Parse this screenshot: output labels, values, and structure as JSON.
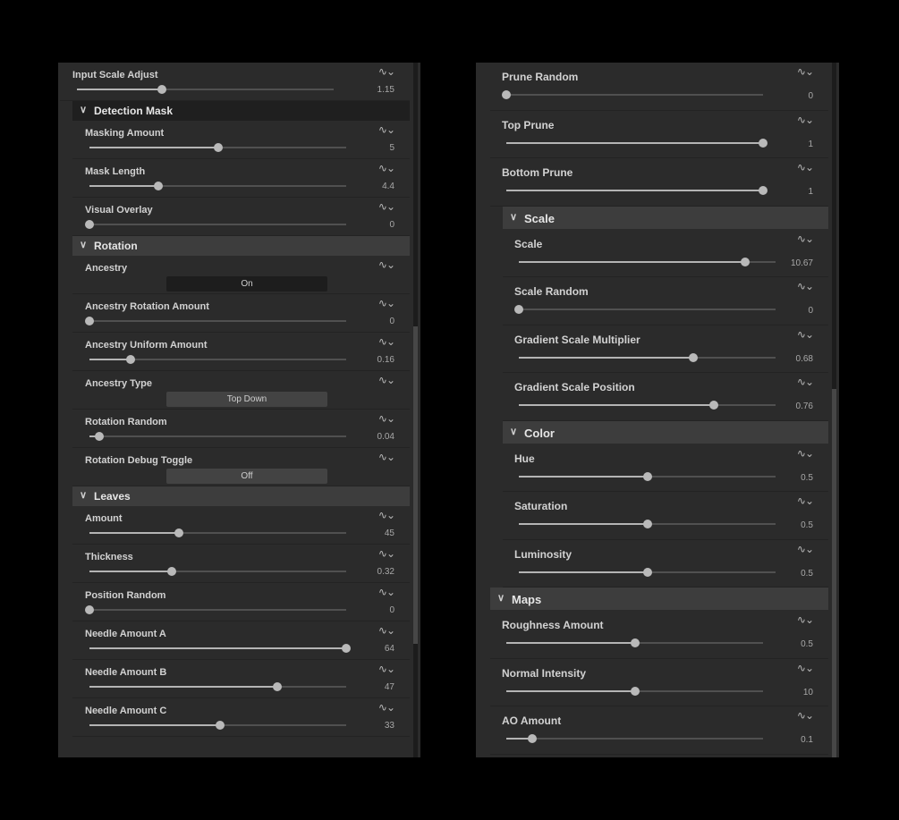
{
  "left_panel": {
    "rows": [
      {
        "label": "Input Scale Adjust",
        "value": "1.15",
        "pos": 0.33
      },
      {
        "section": "Detection Mask",
        "dark": true
      },
      {
        "label": "Masking Amount",
        "value": "5",
        "pos": 0.5
      },
      {
        "label": "Mask Length",
        "value": "4.4",
        "pos": 0.27
      },
      {
        "label": "Visual Overlay",
        "value": "0",
        "pos": 0.0
      },
      {
        "section": "Rotation"
      },
      {
        "label": "Ancestry",
        "toggle": "On",
        "dark": true
      },
      {
        "label": "Ancestry Rotation Amount",
        "value": "0",
        "pos": 0.0
      },
      {
        "label": "Ancestry Uniform Amount",
        "value": "0.16",
        "pos": 0.16
      },
      {
        "label": "Ancestry Type",
        "toggle": "Top Down"
      },
      {
        "label": "Rotation Random",
        "value": "0.04",
        "pos": 0.04
      },
      {
        "label": "Rotation Debug Toggle",
        "toggle": "Off"
      },
      {
        "section": "Leaves"
      },
      {
        "label": "Amount",
        "value": "45",
        "pos": 0.35
      },
      {
        "label": "Thickness",
        "value": "0.32",
        "pos": 0.32
      },
      {
        "label": "Position Random",
        "value": "0",
        "pos": 0.0
      },
      {
        "label": "Needle Amount A",
        "value": "64",
        "pos": 1.0
      },
      {
        "label": "Needle Amount B",
        "value": "47",
        "pos": 0.73
      },
      {
        "label": "Needle Amount C",
        "value": "33",
        "pos": 0.51
      }
    ]
  },
  "right_panel": {
    "rows": [
      {
        "label": "Prune Random",
        "value": "0",
        "pos": 0.0
      },
      {
        "label": "Top Prune",
        "value": "1",
        "pos": 1.0
      },
      {
        "label": "Bottom Prune",
        "value": "1",
        "pos": 1.0
      },
      {
        "section": "Scale",
        "indent": true
      },
      {
        "label": "Scale",
        "value": "10.67",
        "pos": 0.88,
        "indent": true
      },
      {
        "label": "Scale Random",
        "value": "0",
        "pos": 0.0,
        "indent": true
      },
      {
        "label": "Gradient Scale Multiplier",
        "value": "0.68",
        "pos": 0.68,
        "indent": true
      },
      {
        "label": "Gradient Scale Position",
        "value": "0.76",
        "pos": 0.76,
        "indent": true
      },
      {
        "section": "Color",
        "indent": true
      },
      {
        "label": "Hue",
        "value": "0.5",
        "pos": 0.5,
        "indent": true
      },
      {
        "label": "Saturation",
        "value": "0.5",
        "pos": 0.5,
        "indent": true
      },
      {
        "label": "Luminosity",
        "value": "0.5",
        "pos": 0.5,
        "indent": true
      },
      {
        "section": "Maps"
      },
      {
        "label": "Roughness Amount",
        "value": "0.5",
        "pos": 0.5
      },
      {
        "label": "Normal Intensity",
        "value": "10",
        "pos": 0.5
      },
      {
        "label": "AO Amount",
        "value": "0.1",
        "pos": 0.1
      }
    ]
  },
  "icons": {
    "expand": "chevron-down-icon",
    "keyframe": "curve-wave-icon"
  }
}
